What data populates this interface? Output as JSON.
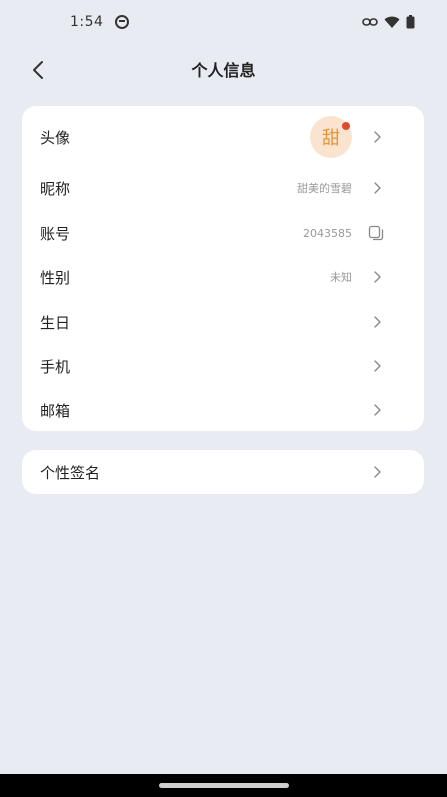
{
  "status_bar": {
    "time": "1:54",
    "icons": [
      "app-indicator-icon",
      "link-icon",
      "wifi-icon",
      "battery-icon"
    ]
  },
  "nav": {
    "back_icon": "chevron-left-icon",
    "title": "个人信息"
  },
  "profile": {
    "avatar_label": "头像",
    "avatar_text": "甜",
    "avatar_colors": {
      "bg": "#fbe4cf",
      "text": "#e8933a",
      "dot": "#e04a2f"
    },
    "nickname_label": "昵称",
    "nickname_value": "甜美的雪碧",
    "account_label": "账号",
    "account_value": "2043585",
    "gender_label": "性别",
    "gender_value": "未知",
    "birthday_label": "生日",
    "phone_label": "手机",
    "email_label": "邮箱"
  },
  "signature": {
    "label": "个性签名"
  },
  "colors": {
    "background": "#e8ecf2",
    "card": "#ffffff",
    "muted_text": "#999999"
  }
}
